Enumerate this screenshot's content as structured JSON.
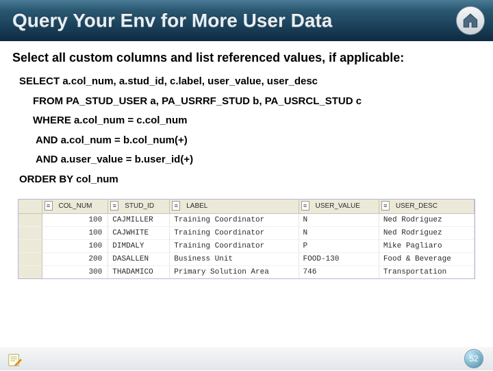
{
  "header": {
    "title": "Query Your Env for More User Data"
  },
  "intro": "Select all custom columns and list referenced values, if applicable:",
  "sql": {
    "select": "SELECT a.col_num, a.stud_id, c.label, user_value, user_desc",
    "from": "FROM PA_STUD_USER a, PA_USRRF_STUD b, PA_USRCL_STUD c",
    "where": "WHERE a.col_num = c.col_num",
    "and1": "AND a.col_num = b.col_num(+)",
    "and2": "AND a.user_value = b.user_id(+)",
    "order": "ORDER BY col_num"
  },
  "grid": {
    "headers": [
      "COL_NUM",
      "STUD_ID",
      "LABEL",
      "USER_VALUE",
      "USER_DESC"
    ],
    "rows": [
      {
        "col_num": "100",
        "stud_id": "CAJMILLER",
        "label": "Training Coordinator",
        "user_value": "N",
        "user_desc": "Ned Rodriguez"
      },
      {
        "col_num": "100",
        "stud_id": "CAJWHITE",
        "label": "Training Coordinator",
        "user_value": "N",
        "user_desc": "Ned Rodriguez"
      },
      {
        "col_num": "100",
        "stud_id": "DIMDALY",
        "label": "Training Coordinator",
        "user_value": "P",
        "user_desc": "Mike Pagliaro"
      },
      {
        "col_num": "200",
        "stud_id": "DASALLEN",
        "label": "Business Unit",
        "user_value": "FOOD-130",
        "user_desc": "Food & Beverage"
      },
      {
        "col_num": "300",
        "stud_id": "THADAMICO",
        "label": "Primary Solution Area",
        "user_value": "746",
        "user_desc": "Transportation"
      }
    ]
  },
  "page_number": "52",
  "chart_data": {
    "type": "table",
    "title": "Query Your Env for More User Data",
    "columns": [
      "COL_NUM",
      "STUD_ID",
      "LABEL",
      "USER_VALUE",
      "USER_DESC"
    ],
    "rows": [
      [
        100,
        "CAJMILLER",
        "Training Coordinator",
        "N",
        "Ned Rodriguez"
      ],
      [
        100,
        "CAJWHITE",
        "Training Coordinator",
        "N",
        "Ned Rodriguez"
      ],
      [
        100,
        "DIMDALY",
        "Training Coordinator",
        "P",
        "Mike Pagliaro"
      ],
      [
        200,
        "DASALLEN",
        "Business Unit",
        "FOOD-130",
        "Food & Beverage"
      ],
      [
        300,
        "THADAMICO",
        "Primary Solution Area",
        "746",
        "Transportation"
      ]
    ]
  }
}
